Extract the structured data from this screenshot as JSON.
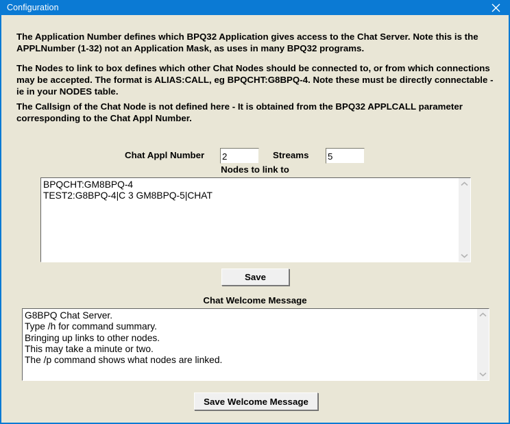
{
  "window": {
    "title": "Configuration",
    "close_icon": "close-icon",
    "titlebar_color": "#0b7ad4",
    "background_color": "#e9e6d6"
  },
  "help_text": {
    "paragraph1": "The Application Number defines which BPQ32 Application gives access to the Chat Server. Note this is the APPLNumber (1-32) not an Application Mask, as uses in many BPQ32 programs.",
    "paragraph2": "The Nodes to link to box defines which other Chat Nodes should be connected to, or from which connections may be accepted. The format is ALIAS:CALL, eg BPQCHT:G8BPQ-4. Note these must be directly connectable - ie in your NODES table.",
    "paragraph3": "The Callsign of the Chat Node is not defined here - It is obtained from the BPQ32 APPLCALL parameter corresponding to the Chat Appl Number."
  },
  "fields": {
    "chat_appl_number": {
      "label": "Chat Appl Number",
      "value": "2",
      "placeholder": ""
    },
    "streams": {
      "label": "Streams",
      "value": "5",
      "placeholder": ""
    }
  },
  "nodes_section": {
    "label": "Nodes to link to",
    "value": "BPQCHT:GM8BPQ-4\nTEST2:G8BPQ-4|C 3 GM8BPQ-5|CHAT",
    "placeholder": "",
    "scroll_up_icon": "chevron-up-icon",
    "scroll_down_icon": "chevron-down-icon",
    "save_label": "Save"
  },
  "welcome_section": {
    "label": "Chat Welcome Message",
    "value": "G8BPQ Chat Server.\nType /h for command summary.\nBringing up links to other nodes.\nThis may take a minute or two.\nThe /p command shows what nodes are linked.",
    "placeholder": "",
    "scroll_up_icon": "chevron-up-icon",
    "scroll_down_icon": "chevron-down-icon",
    "save_label": "Save Welcome Message"
  }
}
